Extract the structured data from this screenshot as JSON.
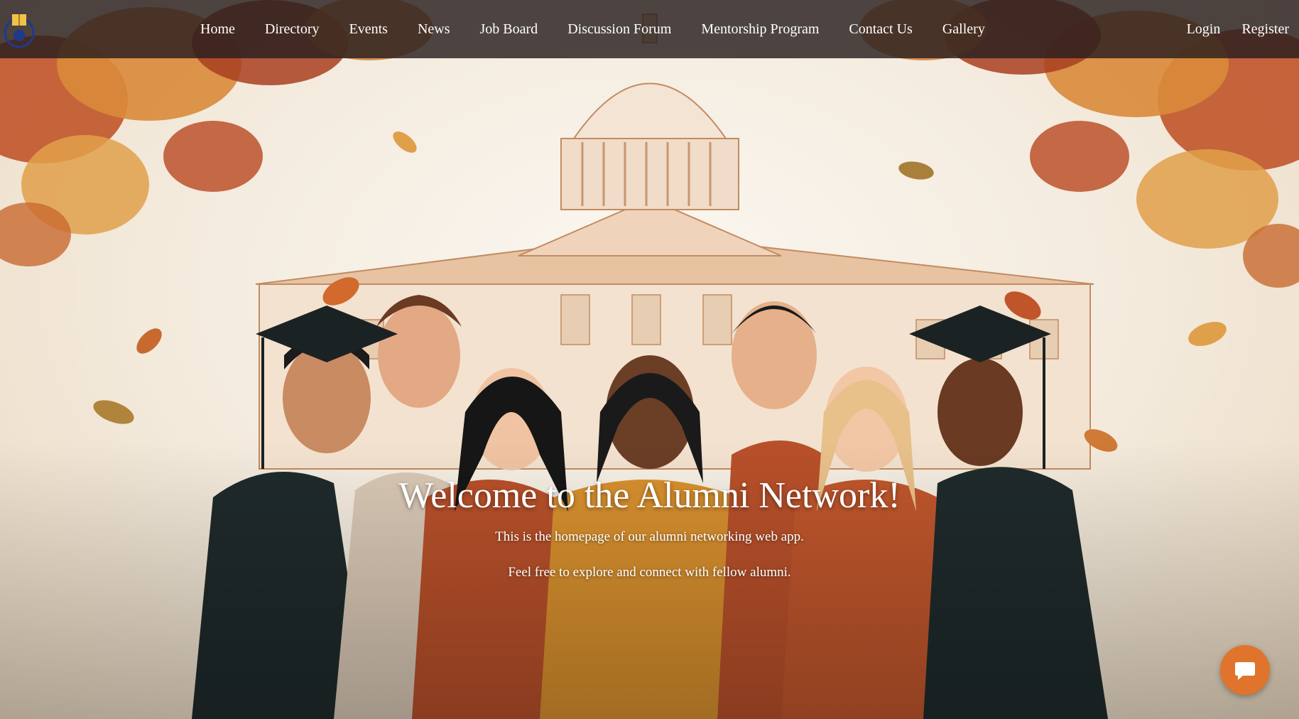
{
  "nav": {
    "links": [
      "Home",
      "Directory",
      "Events",
      "News",
      "Job Board",
      "Discussion Forum",
      "Mentorship Program",
      "Contact Us",
      "Gallery"
    ],
    "login": "Login",
    "register": "Register"
  },
  "hero": {
    "title": "Welcome to the Alumni Network!",
    "line1": "This is the homepage of our alumni networking web app.",
    "line2": "Feel free to explore and connect with fellow alumni."
  },
  "chat": {
    "icon": "chat-bubble-icon"
  },
  "colors": {
    "navbar": "#2a1f1f",
    "chat_button": "#e0742c",
    "text": "#ffffff"
  }
}
